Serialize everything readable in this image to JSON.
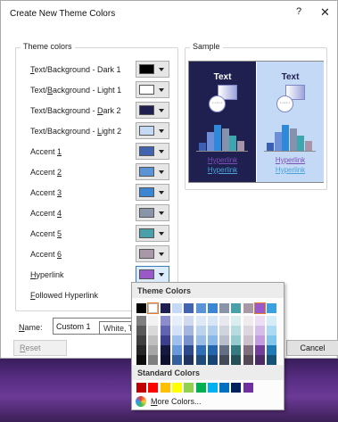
{
  "dialog": {
    "title": "Create New Theme Colors",
    "help_glyph": "?",
    "close_glyph": "✕"
  },
  "theme_colors": {
    "group_label": "Theme colors",
    "rows": [
      {
        "name": "row-text-bg-dark-1",
        "pre": "",
        "u": "T",
        "post": "ext/Background - Dark 1",
        "color": "#000000"
      },
      {
        "name": "row-text-bg-light-1",
        "pre": "Text/",
        "u": "B",
        "post": "ackground - Light 1",
        "color": "#ffffff"
      },
      {
        "name": "row-text-bg-dark-2",
        "pre": "Text/Background - ",
        "u": "D",
        "post": "ark 2",
        "color": "#1f2050"
      },
      {
        "name": "row-text-bg-light-2",
        "pre": "Text/Background - ",
        "u": "L",
        "post": "ight 2",
        "color": "#c4d9f5"
      },
      {
        "name": "row-accent-1",
        "pre": "Accent ",
        "u": "1",
        "post": "",
        "color": "#4263b0"
      },
      {
        "name": "row-accent-2",
        "pre": "Accent ",
        "u": "2",
        "post": "",
        "color": "#5b94d6"
      },
      {
        "name": "row-accent-3",
        "pre": "Accent ",
        "u": "3",
        "post": "",
        "color": "#3a86d4"
      },
      {
        "name": "row-accent-4",
        "pre": "Accent ",
        "u": "4",
        "post": "",
        "color": "#8a94a8"
      },
      {
        "name": "row-accent-5",
        "pre": "Accent ",
        "u": "5",
        "post": "",
        "color": "#4aa0a8"
      },
      {
        "name": "row-accent-6",
        "pre": "Accent ",
        "u": "6",
        "post": "",
        "color": "#a898a8"
      },
      {
        "name": "row-hyperlink",
        "pre": "",
        "u": "H",
        "post": "yperlink",
        "color": "#9a58c8"
      },
      {
        "name": "row-followed-hyperlink",
        "pre": "",
        "u": "F",
        "post": "ollowed Hyperlink",
        "color": null
      }
    ]
  },
  "sample": {
    "group_label": "Sample",
    "text_label": "Text",
    "circle_text": "·····",
    "hyperlink_label": "Hyperlink",
    "dark_bars": [
      "#3b5fb5",
      "#6c8fd8",
      "#2f88d8",
      "#8592ad",
      "#3ea6ae",
      "#a794a8"
    ],
    "light_bars": [
      "#3b5fb5",
      "#6c8fd8",
      "#2f88d8",
      "#8592ad",
      "#3ea6ae",
      "#a794a8"
    ]
  },
  "name_field": {
    "label_u": "N",
    "label_rest": "ame:",
    "value": "Custom 1"
  },
  "tooltip": "White, Text 1",
  "buttons": {
    "reset_u": "R",
    "reset_rest": "eset",
    "cancel": "Cancel"
  },
  "picker": {
    "theme_header": "Theme Colors",
    "standard_header": "Standard Colors",
    "more_u": "M",
    "more_rest": "ore Colors...",
    "theme_columns": [
      [
        "#000000",
        "#7f7f7f",
        "#595959",
        "#3f3f3f",
        "#262626",
        "#0c0c0c"
      ],
      [
        "#ffffff",
        "#f2f2f2",
        "#d9d9d9",
        "#bfbfbf",
        "#a6a6a6",
        "#7f7f7f"
      ],
      [
        "#1f2050",
        "#8a8ccc",
        "#6164b0",
        "#3c3f8a",
        "#171840",
        "#0f1030"
      ],
      [
        "#c4d9f5",
        "#e6eefb",
        "#d3e2f8",
        "#9fbfec",
        "#6a98dc",
        "#335f9e"
      ],
      [
        "#4263b0",
        "#d2daf0",
        "#a6b6e0",
        "#7a91d0",
        "#2e4a8c",
        "#1f3260"
      ],
      [
        "#5b94d6",
        "#dde9f6",
        "#bcd3ee",
        "#9abde5",
        "#2f6db6",
        "#1f4a7a"
      ],
      [
        "#3a86d4",
        "#d8e7f7",
        "#b0cfef",
        "#89b7e8",
        "#2366ae",
        "#174474"
      ],
      [
        "#8a94a8",
        "#e7e9ee",
        "#d0d4dc",
        "#b8becb",
        "#646e84",
        "#434a58"
      ],
      [
        "#4aa0a8",
        "#dbeeef",
        "#b7dcdf",
        "#93cbcf",
        "#357a80",
        "#245156"
      ],
      [
        "#a898a8",
        "#efebef",
        "#ded6de",
        "#cbc1cb",
        "#7e6e7e",
        "#544954"
      ],
      [
        "#9a58c8",
        "#ebdef4",
        "#d6bde9",
        "#c29cde",
        "#723e9a",
        "#4c2a66"
      ],
      [
        "#3aa0e0",
        "#d6ecf9",
        "#acd9f3",
        "#83c6ec",
        "#217ab3",
        "#175178"
      ]
    ],
    "standard_colors": [
      "#c00000",
      "#ff0000",
      "#ffc000",
      "#ffff00",
      "#92d050",
      "#00b050",
      "#00b0f0",
      "#0070c0",
      "#002060",
      "#7030a0"
    ]
  }
}
